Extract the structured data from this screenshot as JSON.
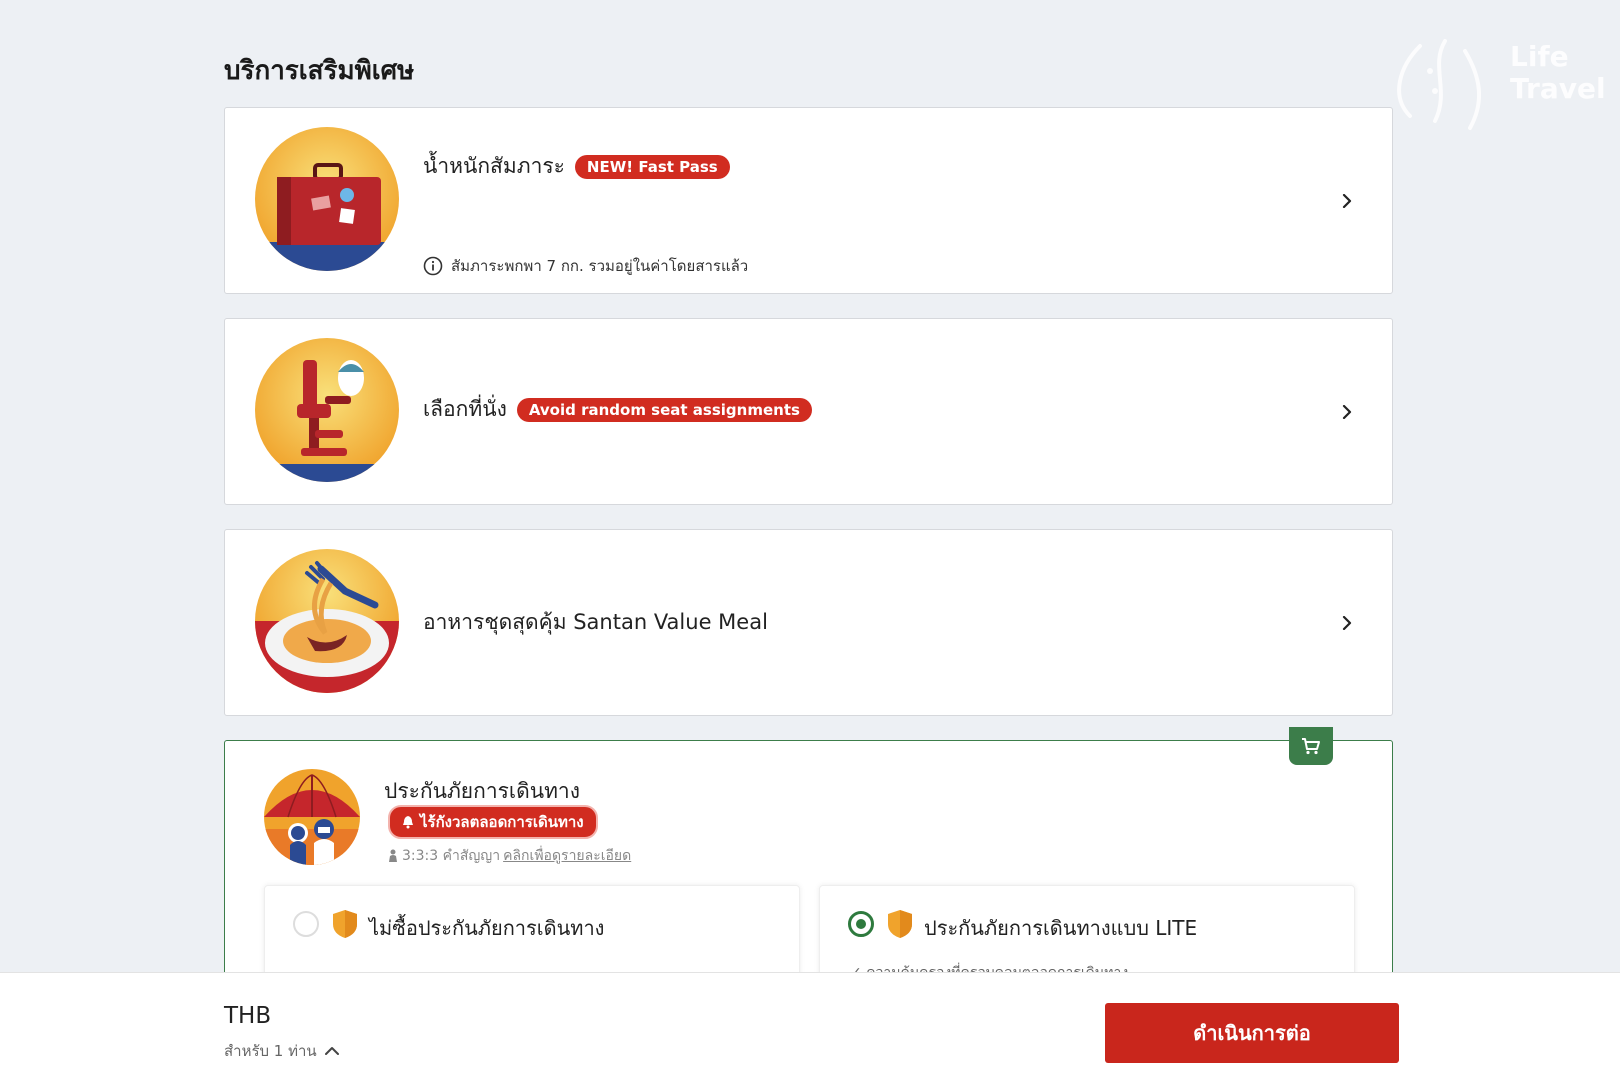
{
  "page": {
    "title": "บริการเสริมพิเศษ",
    "watermark_text": "Life Travel"
  },
  "addons": {
    "baggage": {
      "title": "น้ำหนักสัมภาระ",
      "badge": "NEW! Fast Pass",
      "info": "สัมภาระพกพา 7 กก. รวมอยู่ในค่าโดยสารแล้ว",
      "icon": "suitcase-icon"
    },
    "seat": {
      "title": "เลือกที่นั่ง",
      "badge": "Avoid random seat assignments",
      "icon": "airplane-seat-icon"
    },
    "meal": {
      "title": "อาหารชุดสุดคุ้ม Santan Value Meal",
      "icon": "meal-plate-icon"
    }
  },
  "insurance": {
    "title": "ประกันภัยการเดินทาง",
    "badge": "ไร้กังวลตลอดการเดินทาง",
    "terms_prefix": "3:3:3 คำสัญญา",
    "terms_link": "คลิกเพื่อดูรายละเอียด",
    "options": [
      {
        "label": "ไม่ซื้อประกันภัยการเดินทาง",
        "selected": false
      },
      {
        "label": "ประกันภัยการเดินทางแบบ LITE",
        "selected": true,
        "sub": "ความคุ้มครองที่ครอบคลุมตลอดการเดินทาง"
      }
    ]
  },
  "footer": {
    "currency": "THB",
    "pax": "สำหรับ 1 ท่าน",
    "continue_label": "ดำเนินการต่อ"
  },
  "colors": {
    "brand_red": "#d12c20",
    "selected_green": "#2e7a3e"
  }
}
